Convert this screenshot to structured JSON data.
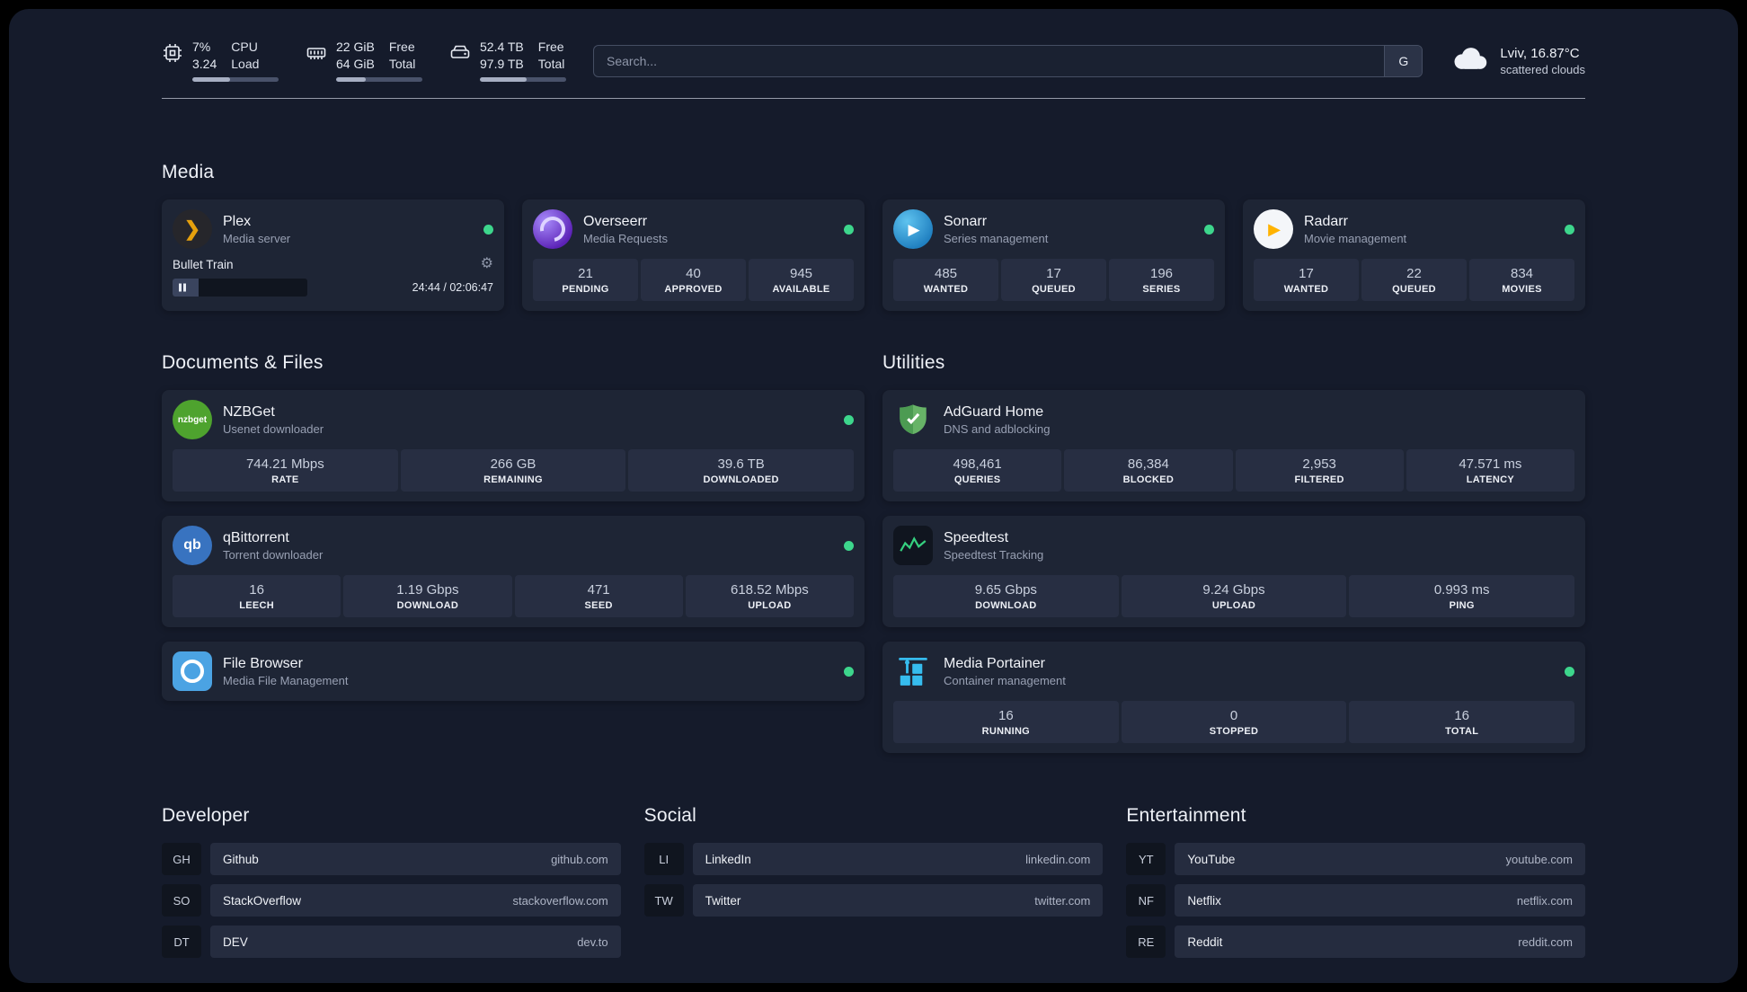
{
  "header": {
    "cpu": {
      "line1_value": "7%",
      "line2_value": "3.24",
      "line1_label": "CPU",
      "line2_label": "Load",
      "bar_style": "width:44%"
    },
    "memory": {
      "line1_value": "22 GiB",
      "line2_value": "64 GiB",
      "line1_label": "Free",
      "line2_label": "Total",
      "bar_style": "width:34%"
    },
    "disk": {
      "line1_value": "52.4 TB",
      "line2_value": "97.9 TB",
      "line1_label": "Free",
      "line2_label": "Total",
      "bar_style": "width:54%"
    },
    "search": {
      "placeholder": "Search...",
      "button_label": "G"
    },
    "weather": {
      "location": "Lviv, 16.87°C",
      "condition": "scattered clouds"
    }
  },
  "icons": {
    "gear": "⚙",
    "plex_glyph": "❯",
    "sonarr_glyph": "▶",
    "radarr_glyph": "▶",
    "nzbget_text": "nzbget",
    "qbittorrent_text": "qb"
  },
  "sections": {
    "media": {
      "title": "Media",
      "cards": [
        {
          "name": "Plex",
          "subtitle": "Media server",
          "online": true,
          "now_playing": {
            "title": "Bullet Train",
            "time": "24:44 / 02:06:47",
            "progress_style": "width:19.5%"
          }
        },
        {
          "name": "Overseerr",
          "subtitle": "Media Requests",
          "online": true,
          "stats": [
            {
              "value": "21",
              "label": "PENDING"
            },
            {
              "value": "40",
              "label": "APPROVED"
            },
            {
              "value": "945",
              "label": "AVAILABLE"
            }
          ]
        },
        {
          "name": "Sonarr",
          "subtitle": "Series management",
          "online": true,
          "stats": [
            {
              "value": "485",
              "label": "WANTED"
            },
            {
              "value": "17",
              "label": "QUEUED"
            },
            {
              "value": "196",
              "label": "SERIES"
            }
          ]
        },
        {
          "name": "Radarr",
          "subtitle": "Movie management",
          "online": true,
          "stats": [
            {
              "value": "17",
              "label": "WANTED"
            },
            {
              "value": "22",
              "label": "QUEUED"
            },
            {
              "value": "834",
              "label": "MOVIES"
            }
          ]
        }
      ]
    },
    "documents": {
      "title": "Documents & Files",
      "cards": [
        {
          "name": "NZBGet",
          "subtitle": "Usenet downloader",
          "online": true,
          "stats": [
            {
              "value": "744.21 Mbps",
              "label": "RATE"
            },
            {
              "value": "266 GB",
              "label": "REMAINING"
            },
            {
              "value": "39.6 TB",
              "label": "DOWNLOADED"
            }
          ]
        },
        {
          "name": "qBittorrent",
          "subtitle": "Torrent downloader",
          "online": true,
          "stats": [
            {
              "value": "16",
              "label": "LEECH"
            },
            {
              "value": "1.19 Gbps",
              "label": "DOWNLOAD"
            },
            {
              "value": "471",
              "label": "SEED"
            },
            {
              "value": "618.52 Mbps",
              "label": "UPLOAD"
            }
          ]
        },
        {
          "name": "File Browser",
          "subtitle": "Media File Management",
          "online": true
        }
      ]
    },
    "utilities": {
      "title": "Utilities",
      "cards": [
        {
          "name": "AdGuard Home",
          "subtitle": "DNS and adblocking",
          "stats": [
            {
              "value": "498,461",
              "label": "QUERIES"
            },
            {
              "value": "86,384",
              "label": "BLOCKED"
            },
            {
              "value": "2,953",
              "label": "FILTERED"
            },
            {
              "value": "47.571 ms",
              "label": "LATENCY"
            }
          ]
        },
        {
          "name": "Speedtest",
          "subtitle": "Speedtest Tracking",
          "stats": [
            {
              "value": "9.65 Gbps",
              "label": "DOWNLOAD"
            },
            {
              "value": "9.24 Gbps",
              "label": "UPLOAD"
            },
            {
              "value": "0.993 ms",
              "label": "PING"
            }
          ]
        },
        {
          "name": "Media Portainer",
          "subtitle": "Container management",
          "online": true,
          "stats": [
            {
              "value": "16",
              "label": "RUNNING"
            },
            {
              "value": "0",
              "label": "STOPPED"
            },
            {
              "value": "16",
              "label": "TOTAL"
            }
          ]
        }
      ]
    }
  },
  "bookmarks": {
    "groups": [
      {
        "title": "Developer",
        "items": [
          {
            "abbr": "GH",
            "name": "Github",
            "url": "github.com"
          },
          {
            "abbr": "SO",
            "name": "StackOverflow",
            "url": "stackoverflow.com"
          },
          {
            "abbr": "DT",
            "name": "DEV",
            "url": "dev.to"
          }
        ]
      },
      {
        "title": "Social",
        "items": [
          {
            "abbr": "LI",
            "name": "LinkedIn",
            "url": "linkedin.com"
          },
          {
            "abbr": "TW",
            "name": "Twitter",
            "url": "twitter.com"
          }
        ]
      },
      {
        "title": "Entertainment",
        "items": [
          {
            "abbr": "YT",
            "name": "YouTube",
            "url": "youtube.com"
          },
          {
            "abbr": "NF",
            "name": "Netflix",
            "url": "netflix.com"
          },
          {
            "abbr": "RE",
            "name": "Reddit",
            "url": "reddit.com"
          }
        ]
      }
    ]
  },
  "colors": {
    "background": "#151b2b",
    "card": "#1e2535",
    "stat_box": "#272e42",
    "status_online": "#3dd68c",
    "plex_amber": "#e5a00d",
    "text_primary": "#eef1f7",
    "text_secondary": "#98a0b3"
  }
}
